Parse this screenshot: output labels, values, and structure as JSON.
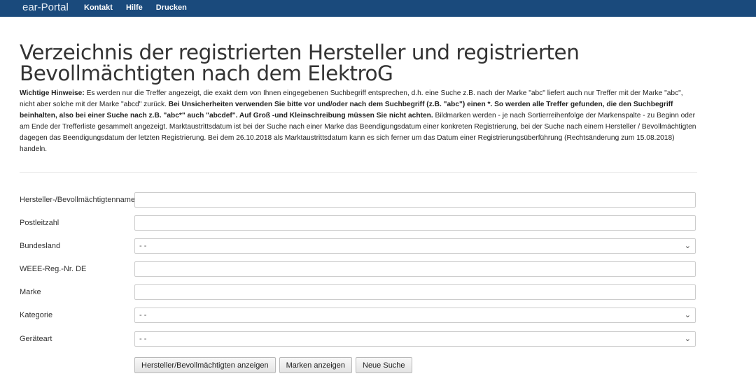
{
  "header": {
    "brand": "ear-Portal",
    "nav": [
      "Kontakt",
      "Hilfe",
      "Drucken"
    ]
  },
  "page_title": "Verzeichnis der registrierten Hersteller und registrierten Bevollmächtigten nach dem ElektroG",
  "notice": {
    "label": "Wichtige Hinweise:",
    "text1": " Es werden nur die Treffer angezeigt, die exakt dem von Ihnen eingegebenen Suchbegriff entsprechen, d.h. eine Suche z.B. nach der Marke \"abc\" liefert auch nur Treffer mit der Marke \"abc\", nicht aber solche mit der Marke \"abcd\" zurück. ",
    "bold": "Bei Unsicherheiten verwenden Sie bitte vor und/oder nach dem Suchbegriff (z.B. \"abc\") einen *. So werden alle Treffer gefunden, die den Suchbegriff beinhalten, also bei einer Suche nach z.B. \"abc*\" auch \"abcdef\". Auf Groß -und Kleinschreibung müssen Sie nicht achten.",
    "text2": " Bildmarken werden - je nach Sortierreihenfolge der Markenspalte - zu Beginn oder am Ende der Trefferliste gesammelt angezeigt. Marktaustrittsdatum ist bei der Suche nach einer Marke das Beendigungsdatum einer konkreten Registrierung, bei der Suche nach einem Hersteller / Bevollmächtigten dagegen das Beendigungsdatum der letzten Registrierung. Bei dem 26.10.2018 als Marktaustrittsdatum kann es sich ferner um das Datum einer Registrierungsüberführung (Rechtsänderung zum 15.08.2018) handeln."
  },
  "form": {
    "hersteller": {
      "label": "Hersteller-/Bevollmächtigtenname",
      "value": ""
    },
    "plz": {
      "label": "Postleitzahl",
      "value": ""
    },
    "bundesland": {
      "label": "Bundesland",
      "value": "- -"
    },
    "weee": {
      "label": "WEEE-Reg.-Nr. DE",
      "value": ""
    },
    "marke": {
      "label": "Marke",
      "value": ""
    },
    "kategorie": {
      "label": "Kategorie",
      "value": "- -"
    },
    "geraeteart": {
      "label": "Geräteart",
      "value": "- -"
    }
  },
  "buttons": {
    "hersteller": "Hersteller/Bevollmächtigten anzeigen",
    "marken": "Marken anzeigen",
    "neu": "Neue Suche"
  }
}
